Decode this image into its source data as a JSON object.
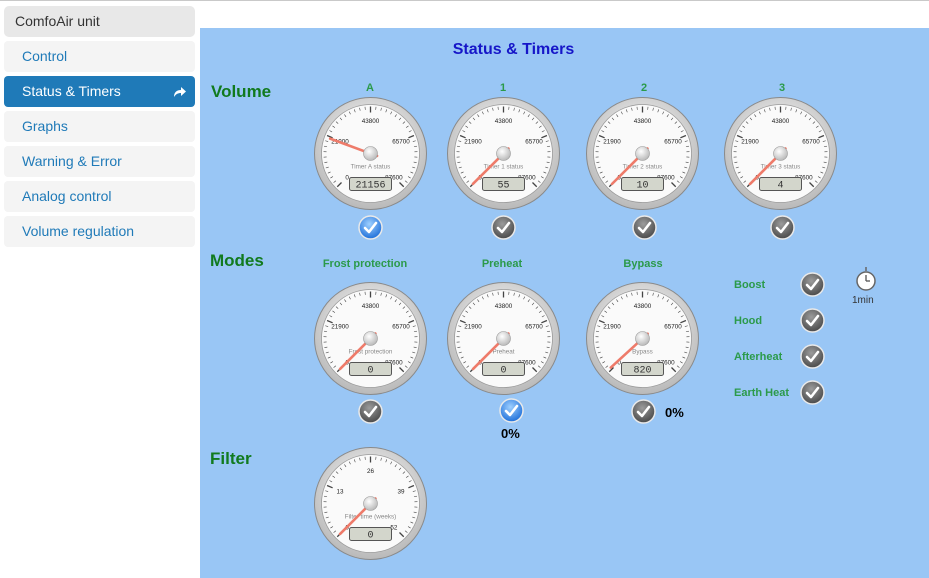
{
  "sidebar": {
    "header": "ComfoAir unit",
    "items": [
      {
        "label": "Control",
        "active": false
      },
      {
        "label": "Status & Timers",
        "active": true
      },
      {
        "label": "Graphs",
        "active": false
      },
      {
        "label": "Warning & Error",
        "active": false
      },
      {
        "label": "Analog control",
        "active": false
      },
      {
        "label": "Volume regulation",
        "active": false
      }
    ]
  },
  "main": {
    "title": "Status & Timers",
    "sections": {
      "volume": "Volume",
      "modes": "Modes",
      "filter": "Filter"
    },
    "volume_gauges": [
      {
        "label": "A",
        "caption": "Timer A status",
        "display": "21156",
        "value": 21156,
        "checkbox": "selected"
      },
      {
        "label": "1",
        "caption": "Timer 1 status",
        "display": "55",
        "value": 55,
        "checkbox": "checked"
      },
      {
        "label": "2",
        "caption": "Timer 2 status",
        "display": "10",
        "value": 10,
        "checkbox": "checked"
      },
      {
        "label": "3",
        "caption": "Timer 3 status",
        "display": "4",
        "value": 4,
        "checkbox": "checked"
      }
    ],
    "mode_gauges": [
      {
        "label": "Frost protection",
        "caption": "Frost protection",
        "display": "0",
        "value": 0,
        "checkbox": "checked",
        "percent": ""
      },
      {
        "label": "Preheat",
        "caption": "Preheat",
        "display": "0",
        "value": 0,
        "checkbox": "selected",
        "percent": "0%"
      },
      {
        "label": "Bypass",
        "caption": "Bypass",
        "display": "820",
        "value": 820,
        "checkbox": "checked",
        "percent": "0%"
      }
    ],
    "timer_scale": {
      "ticks": [
        "0",
        "21900",
        "43800",
        "65700",
        "87600"
      ],
      "max": 87600
    },
    "filter_gauge": {
      "caption": "Filter time (weeks)",
      "display": "0",
      "value": 0,
      "ticks": [
        "0",
        "13",
        "26",
        "39",
        "52"
      ],
      "max": 52
    },
    "mode_switches": [
      {
        "label": "Boost",
        "checkbox": "checked"
      },
      {
        "label": "Hood",
        "checkbox": "checked"
      },
      {
        "label": "Afterheat",
        "checkbox": "checked"
      },
      {
        "label": "Earth Heat",
        "checkbox": "checked"
      }
    ],
    "boost_timer": {
      "icon": "stopwatch-icon",
      "label": "1min"
    }
  },
  "colors": {
    "panel_bg": "#99c6f5",
    "section_title": "#117a1e",
    "gauge_label": "#2b9a4a",
    "page_title": "#1616c8",
    "sidebar_active": "#1f7ab8",
    "needle": "#ee7b6a"
  }
}
